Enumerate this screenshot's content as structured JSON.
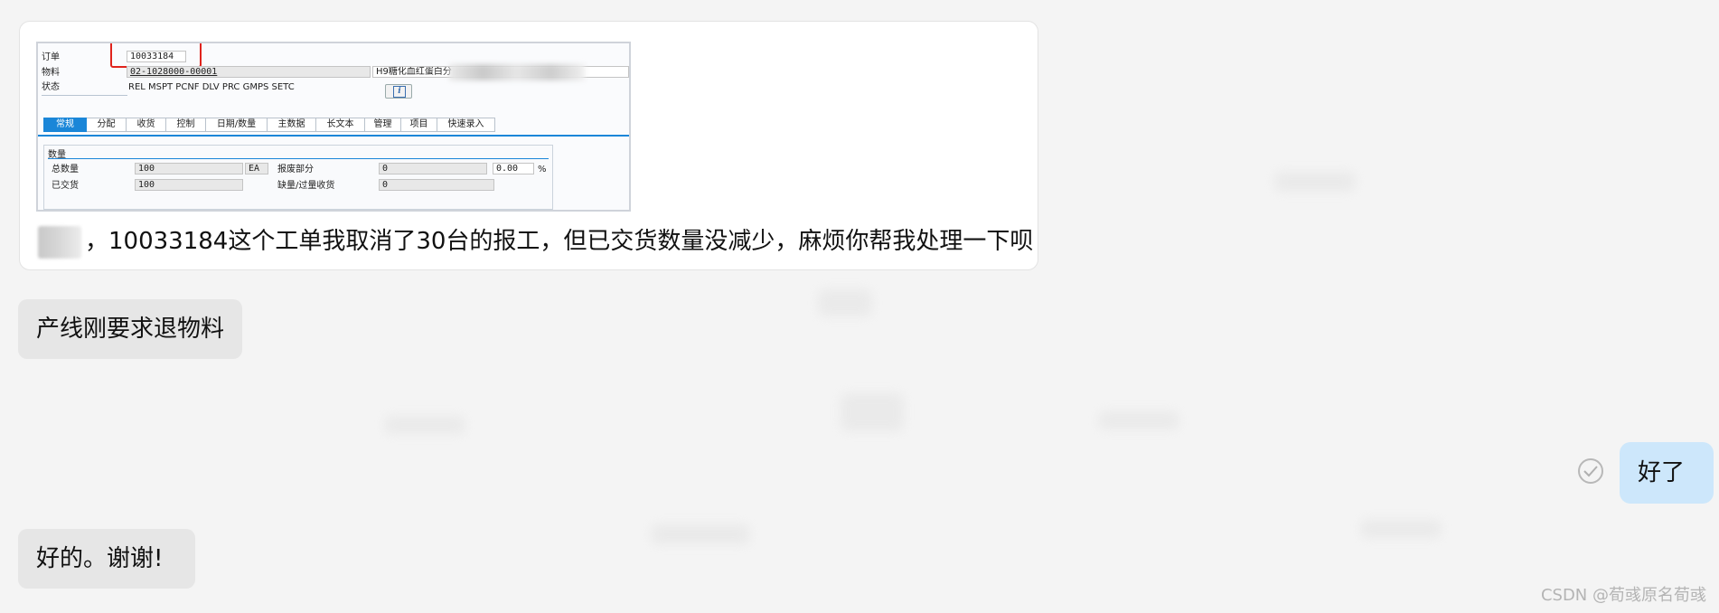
{
  "messages": {
    "m1": {
      "sap": {
        "order_label": "订单",
        "order_value": "10033184",
        "material_label": "物料",
        "material_value": "02-1028000-00001",
        "material_desc": "H9糖化血红蛋白分",
        "status_label": "状态",
        "status_value": "REL  MSPT PCNF DLV  PRC  GMPS SETC",
        "tabs": [
          "常规",
          "分配",
          "收货",
          "控制",
          "日期/数量",
          "主数据",
          "长文本",
          "管理",
          "项目",
          "快速录入"
        ],
        "group_title": "数量",
        "total_qty_label": "总数量",
        "total_qty_value": "100",
        "unit": "EA",
        "scrap_label": "报废部分",
        "scrap_value": "0",
        "scrap_percent": "0.00",
        "percent_sign": "%",
        "delivered_label": "已交货",
        "delivered_value": "100",
        "short_receipt_label": "缺量/过量收货",
        "short_receipt_value": "0"
      },
      "text": "，10033184这个工单我取消了30台的报工，但已交货数量没减少，麻烦你帮我处理一下呗"
    },
    "m2": {
      "text": "产线刚要求退物料"
    },
    "m3": {
      "text": "好了"
    },
    "m4": {
      "text": "好的。谢谢!"
    }
  },
  "watermark": "CSDN @荀彧原名荀彧",
  "colors": {
    "background": "#f4f4f4",
    "incoming_bubble": "#e6e6e6",
    "outgoing_bubble": "#cde7fb",
    "sap_active_tab": "#1a86d8",
    "highlight_box": "#e0231c"
  },
  "icons": [
    "info-icon",
    "read-check-icon"
  ]
}
